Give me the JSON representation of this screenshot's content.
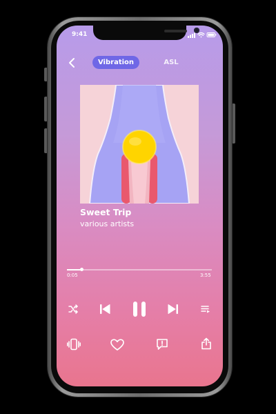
{
  "status_bar": {
    "time": "9:41"
  },
  "header": {
    "tabs": [
      {
        "label": "Vibration",
        "active": true
      },
      {
        "label": "ASL",
        "active": false
      }
    ]
  },
  "track": {
    "title": "Sweet Trip",
    "artist": "various artists"
  },
  "playback": {
    "elapsed": "0:05",
    "duration": "3:55",
    "progress_fraction": 0.1
  },
  "controls": {
    "transport": [
      "shuffle-icon",
      "previous-icon",
      "pause-icon",
      "next-icon",
      "queue-icon"
    ],
    "actions": [
      "vibration-icon",
      "heart-icon",
      "lyrics-icon",
      "share-icon"
    ]
  },
  "colors": {
    "accent": "#6f67e6",
    "gradient_top": "#b79bea",
    "gradient_bottom": "#e9758e",
    "album_background": "#f6d3d8",
    "album_shape": "#a6a3f4",
    "album_sun": "#ffd400",
    "album_figure": "#e9586d"
  }
}
